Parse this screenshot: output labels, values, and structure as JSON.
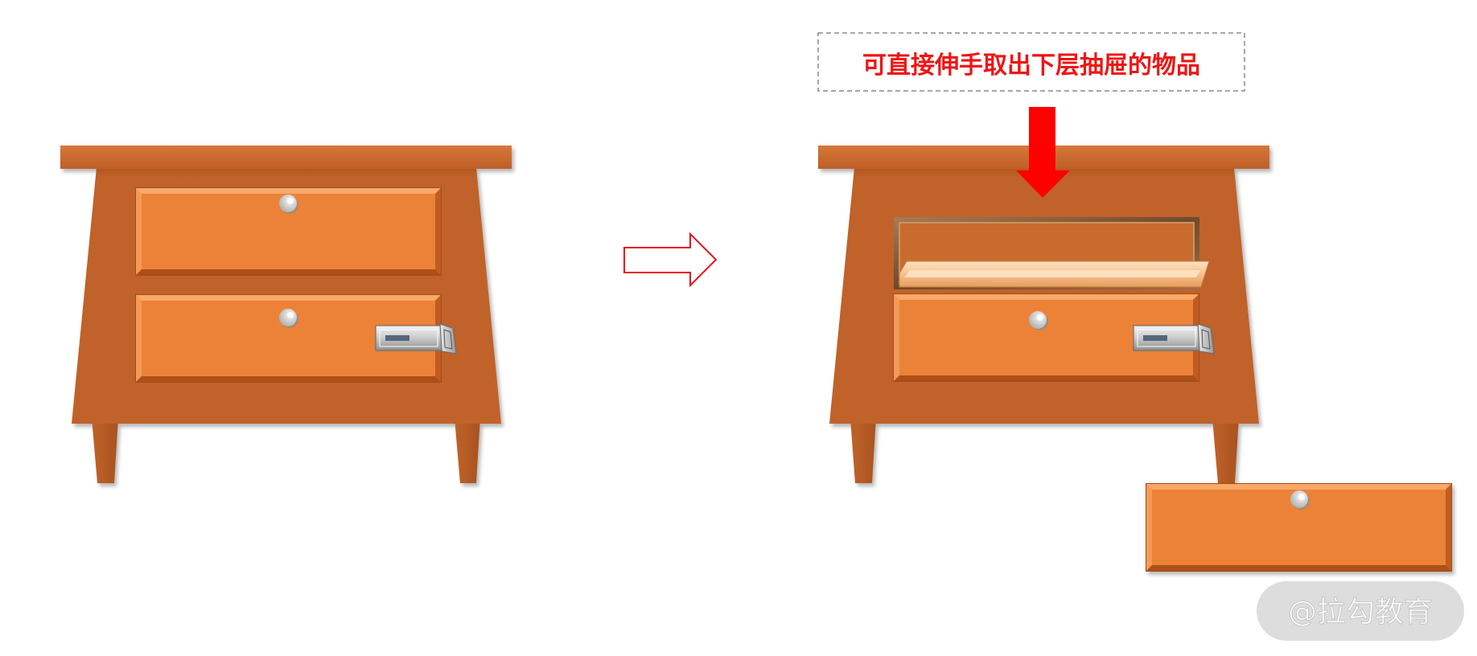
{
  "caption": "可直接伸手取出下层抽屉的物品",
  "watermark": "@拉勾教育",
  "icons": {
    "transition_arrow": "right-arrow-outline-icon",
    "pointer_arrow": "down-arrow-icon"
  },
  "colors": {
    "caption_text": "#f01414",
    "pointer_arrow": "#ff0000",
    "transition_arrow_stroke": "#e8141b",
    "wood_body": "#c0622a",
    "drawer_face": "#ec8238",
    "dashed_border": "#8a8a8a",
    "watermark_bg": "#d9d9d9",
    "watermark_text": "#ffffff"
  }
}
